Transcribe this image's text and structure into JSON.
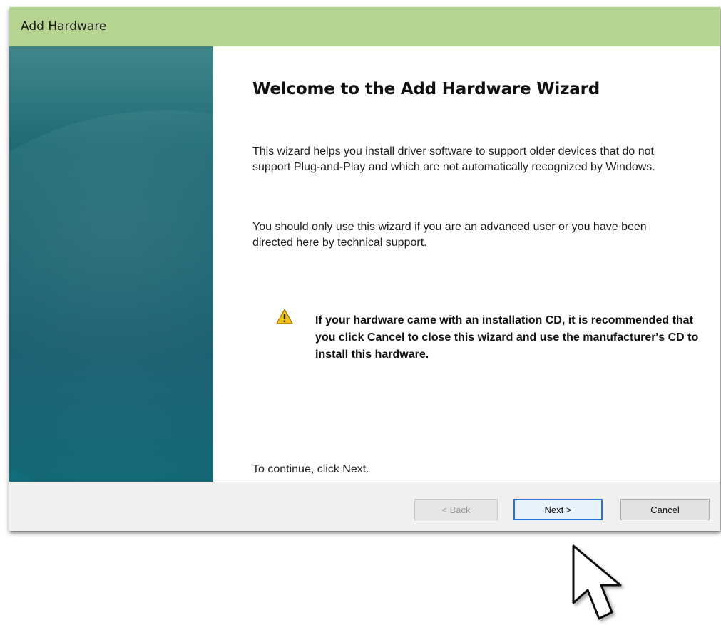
{
  "window": {
    "title": "Add Hardware",
    "titlebar_color": "#b5d492"
  },
  "content": {
    "heading": "Welcome to the Add Hardware Wizard",
    "paragraph1": "This wizard helps you install driver software to support older devices that do not support Plug-and-Play and which are not automatically recognized by Windows.",
    "paragraph2": "You should only use this wizard if you are an advanced user or you have been directed here by technical support.",
    "warning": {
      "icon": "warning-icon",
      "text": "If your hardware came with an installation CD, it is recommended that you click Cancel to close this wizard and use the manufacturer's CD to install this hardware."
    },
    "continue_text": "To continue, click Next."
  },
  "buttons": {
    "back": "< Back",
    "next": "Next >",
    "cancel": "Cancel"
  },
  "cursor": {
    "icon": "mouse-pointer-icon"
  }
}
